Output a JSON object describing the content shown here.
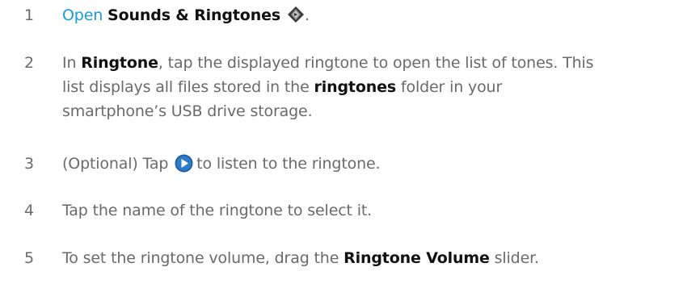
{
  "steps": [
    {
      "number": "1",
      "parts": {
        "link": "Open",
        "bold": "Sounds & Ringtones",
        "end": ".",
        "icon": "sounds-ringtones-icon"
      }
    },
    {
      "number": "2",
      "parts": {
        "a": "In ",
        "b": "Ringtone",
        "c": ", tap the displayed ringtone to open the list of tones. This",
        "d": "list displays all files stored in the ",
        "e": "ringtones",
        "f": " folder in your",
        "g": "smartphone’s USB drive storage."
      }
    },
    {
      "number": "3",
      "parts": {
        "a": "(Optional) Tap",
        "icon": "play-icon",
        "b": "to listen to the ringtone."
      }
    },
    {
      "number": "4",
      "parts": {
        "a": "Tap the name of the ringtone to select it."
      }
    },
    {
      "number": "5",
      "parts": {
        "a": "To set the ringtone volume, drag the ",
        "b": "Ringtone Volume",
        "c": " slider."
      }
    }
  ],
  "colors": {
    "text": "#6a6a6a",
    "link": "#1a9ad6",
    "bold": "#111111"
  }
}
